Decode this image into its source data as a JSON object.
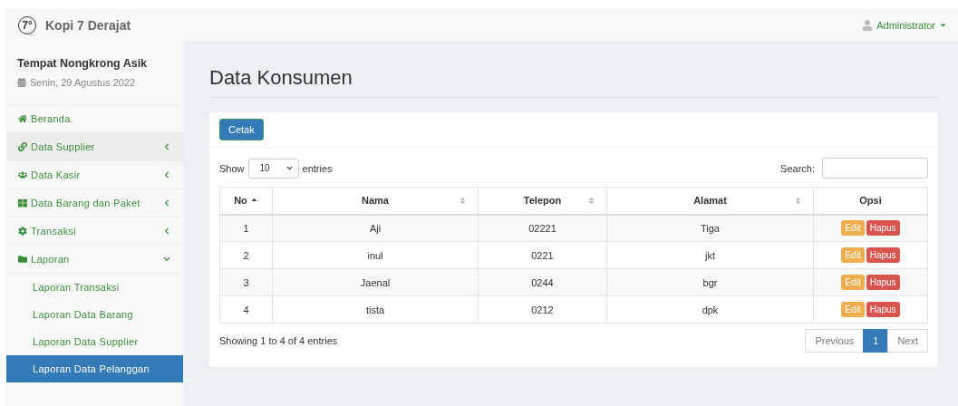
{
  "header": {
    "logo_mark": "7°",
    "brand": "Kopi 7 Derajat",
    "user": "Administrator"
  },
  "sidebar": {
    "title": "Tempat Nongkrong Asik",
    "date": "Senin, 29 Agustus 2022",
    "items": [
      {
        "kind": "home",
        "label": "Beranda",
        "highlighted": false
      },
      {
        "kind": "link",
        "label": "Data Supplier",
        "highlighted": true,
        "expanded": false
      },
      {
        "kind": "users",
        "label": "Data Kasir",
        "highlighted": false,
        "expanded": false
      },
      {
        "kind": "grid",
        "label": "Data Barang dan Paket",
        "highlighted": false,
        "expanded": false
      },
      {
        "kind": "cog",
        "label": "Transaksi",
        "highlighted": false,
        "expanded": false
      },
      {
        "kind": "folder",
        "label": "Laporan",
        "highlighted": false,
        "expanded": true,
        "children": [
          {
            "label": "Laporan Transaksi",
            "selected": false
          },
          {
            "label": "Laporan Data Barang",
            "selected": false
          },
          {
            "label": "Laporan Data Supplier",
            "selected": false
          },
          {
            "label": "Laporan Data Pelanggan",
            "selected": true
          }
        ]
      }
    ]
  },
  "page_title": "Data Konsumen",
  "print_button": "Cetak",
  "length": {
    "prefix": "Show",
    "value": "10",
    "suffix": "entries"
  },
  "search": {
    "label": "Search:"
  },
  "table": {
    "columns": [
      {
        "label": "No",
        "sorted": true
      },
      {
        "label": "Nama",
        "sorted": false
      },
      {
        "label": "Telepon",
        "sorted": false
      },
      {
        "label": "Alamat",
        "sorted": false
      },
      {
        "label": "Opsi"
      }
    ],
    "rows": [
      {
        "cells": [
          "1",
          "Aji",
          "02221",
          "Tiga"
        ],
        "actions": [
          "Edit",
          "Hapus"
        ]
      },
      {
        "cells": [
          "2",
          "inul",
          "0221",
          "jkt"
        ],
        "actions": [
          "Edit",
          "Hapus"
        ]
      },
      {
        "cells": [
          "3",
          "Jaenal",
          "0244",
          "bgr"
        ],
        "actions": [
          "Edit",
          "Hapus"
        ]
      },
      {
        "cells": [
          "4",
          "tista",
          "0212",
          "dpk"
        ],
        "actions": [
          "Edit",
          "Hapus"
        ]
      }
    ]
  },
  "info": "Showing 1 to 4 of 4 entries",
  "pagination": [
    {
      "label": "Previous",
      "selected": false
    },
    {
      "label": "1",
      "selected": true
    },
    {
      "label": "Next",
      "selected": false
    }
  ]
}
